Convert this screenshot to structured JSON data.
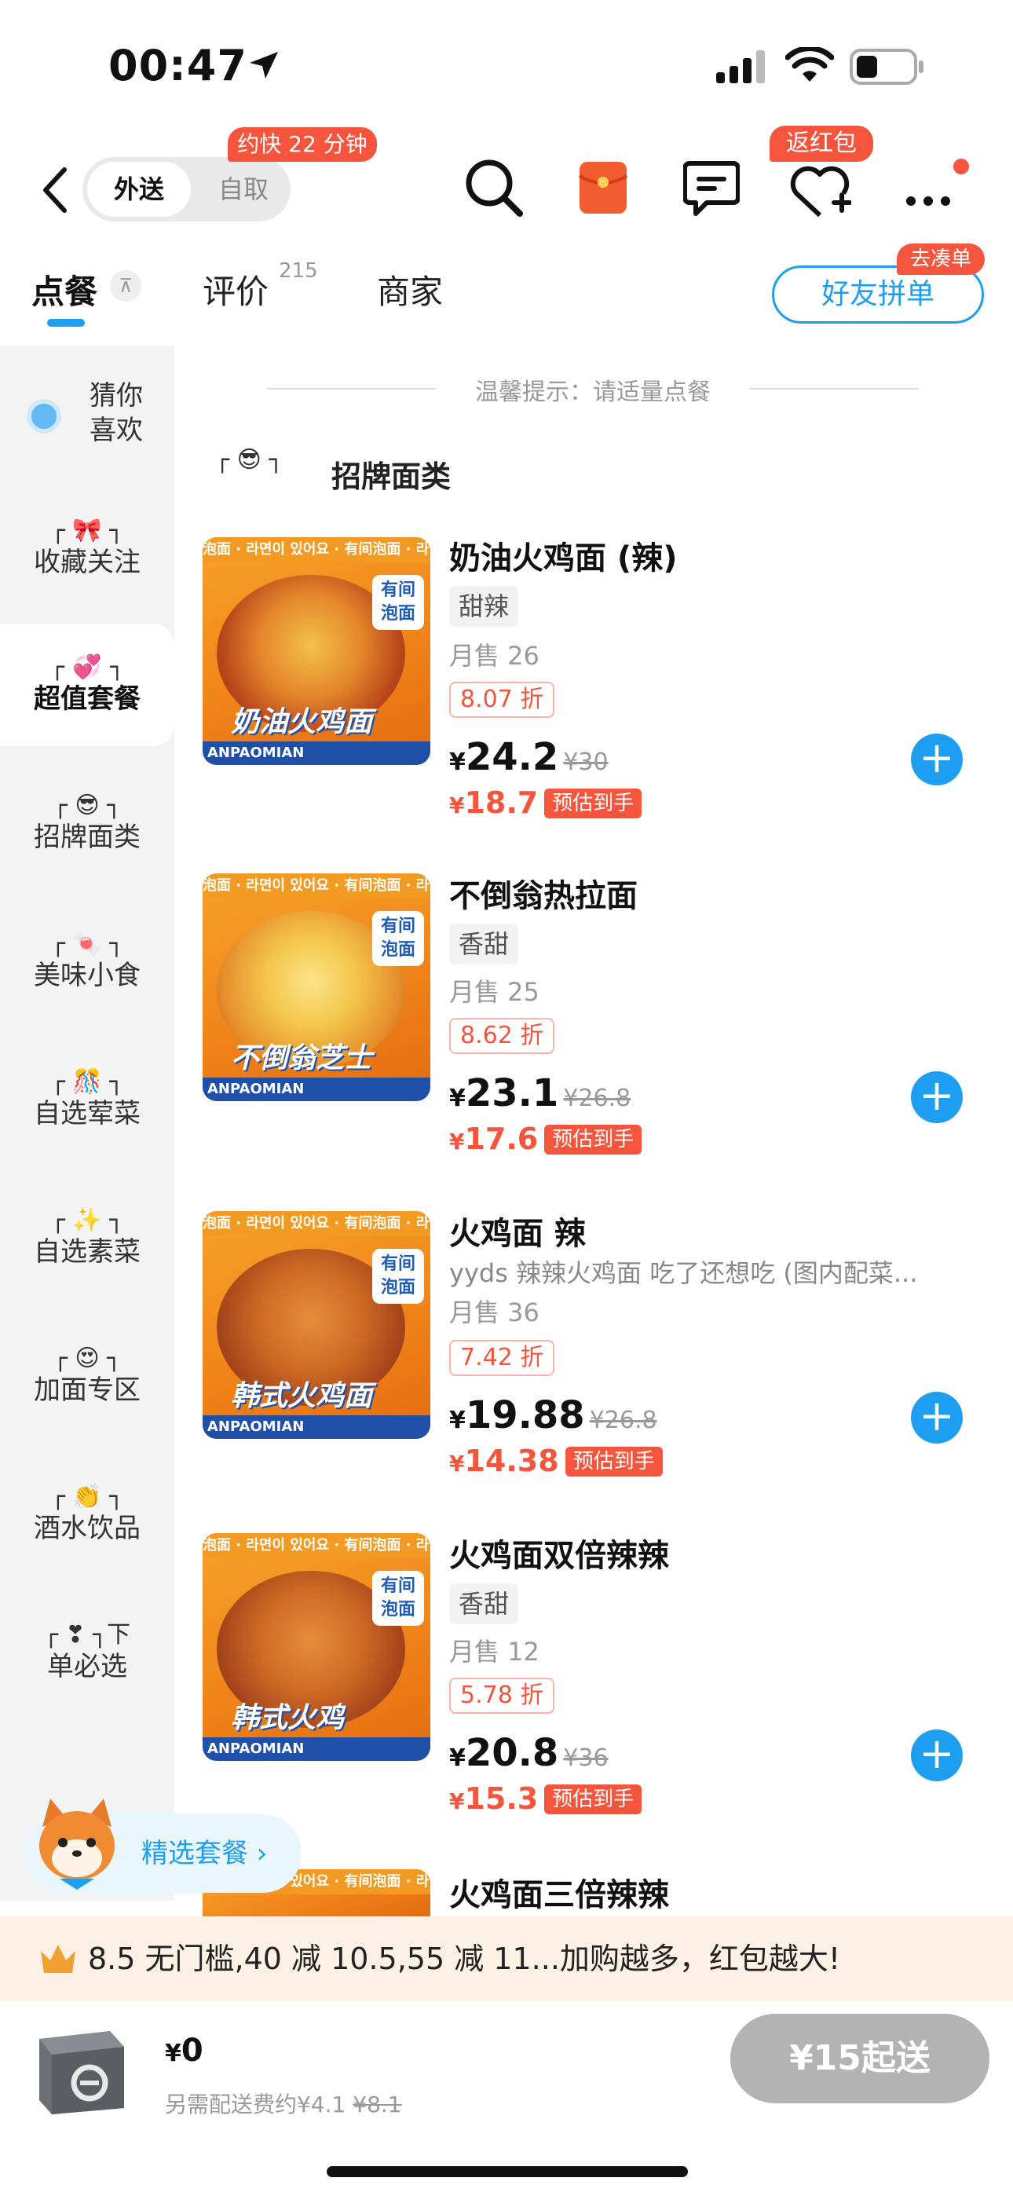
{
  "status_bar": {
    "time": "00:47"
  },
  "header": {
    "mode_active": "外送",
    "mode_inactive": "自取",
    "faster_tag": "约快 22 分钟",
    "hongbao_tag": "返红包"
  },
  "tabs": [
    {
      "label": "点餐",
      "active": true
    },
    {
      "label": "评价",
      "count": "215"
    },
    {
      "label": "商家"
    }
  ],
  "group_order": {
    "label": "好友拼单",
    "tag": "去凑单"
  },
  "sidebar": {
    "items": [
      {
        "icon": "eye-icon",
        "label": "猜你\n喜欢"
      },
      {
        "icon": "bow-icon",
        "label": "收藏关注"
      },
      {
        "icon": "hearts-icon",
        "label": "超值套餐",
        "active": true
      },
      {
        "icon": "sunglasses-icon",
        "label": "招牌面类"
      },
      {
        "icon": "candy-icon",
        "label": "美味小食"
      },
      {
        "icon": "gift-icon",
        "label": "自选荤菜"
      },
      {
        "icon": "sparkles-icon",
        "label": "自选素菜"
      },
      {
        "icon": "heart-eyes-icon",
        "label": "加面专区"
      },
      {
        "icon": "clap-icon",
        "label": "酒水饮品"
      },
      {
        "icon": "exclamation-icon",
        "label": "单必选",
        "prefix": "下"
      }
    ]
  },
  "main": {
    "tip": "温馨提示：请适量点餐",
    "section_title": "招牌面类",
    "products": [
      {
        "name": "奶油火鸡面 (辣)",
        "tag": "甜辣",
        "sold": "月售 26",
        "discount": "8.07 折",
        "price": "24.2",
        "orig_price": "¥30",
        "est_price": "18.7",
        "est_label": "预估到手",
        "img_caption": "奶油火鸡面"
      },
      {
        "name": "不倒翁热拉面",
        "tag": "香甜",
        "sold": "月售 25",
        "discount": "8.62 折",
        "price": "23.1",
        "orig_price": "¥26.8",
        "est_price": "17.6",
        "est_label": "预估到手",
        "img_caption": "不倒翁芝士"
      },
      {
        "name": "火鸡面 辣",
        "desc": "yyds 辣辣火鸡面 吃了还想吃 (图内配菜...",
        "sold": "月售 36",
        "discount": "7.42 折",
        "price": "19.88",
        "orig_price": "¥26.8",
        "est_price": "14.38",
        "est_label": "预估到手",
        "img_caption": "韩式火鸡面"
      },
      {
        "name": "火鸡面双倍辣辣",
        "tag": "香甜",
        "sold": "月售 12",
        "discount": "5.78 折",
        "price": "20.8",
        "orig_price": "¥36",
        "est_price": "15.3",
        "est_label": "预估到手",
        "img_caption": "韩式火鸡"
      },
      {
        "name": "火鸡面三倍辣辣"
      }
    ],
    "img_band": "泡面 · 라면이 있어요 · 有间泡面 · 라면이",
    "img_badge": "有间\n泡面",
    "img_foot": "ANPAOMIAN"
  },
  "floating": {
    "label": "精选套餐 ›"
  },
  "promo": {
    "text": "8.5 无门槛,40 减 10.5,55 减 11...加购越多，红包越大!"
  },
  "cart": {
    "total": "0",
    "delivery_note": "另需配送费约¥4.1",
    "delivery_orig": "¥8.1",
    "checkout_label": "¥15起送"
  },
  "colors": {
    "accent_blue": "#1e9ef0",
    "red": "#f5543d",
    "promo_bg": "#fdf1e5"
  }
}
